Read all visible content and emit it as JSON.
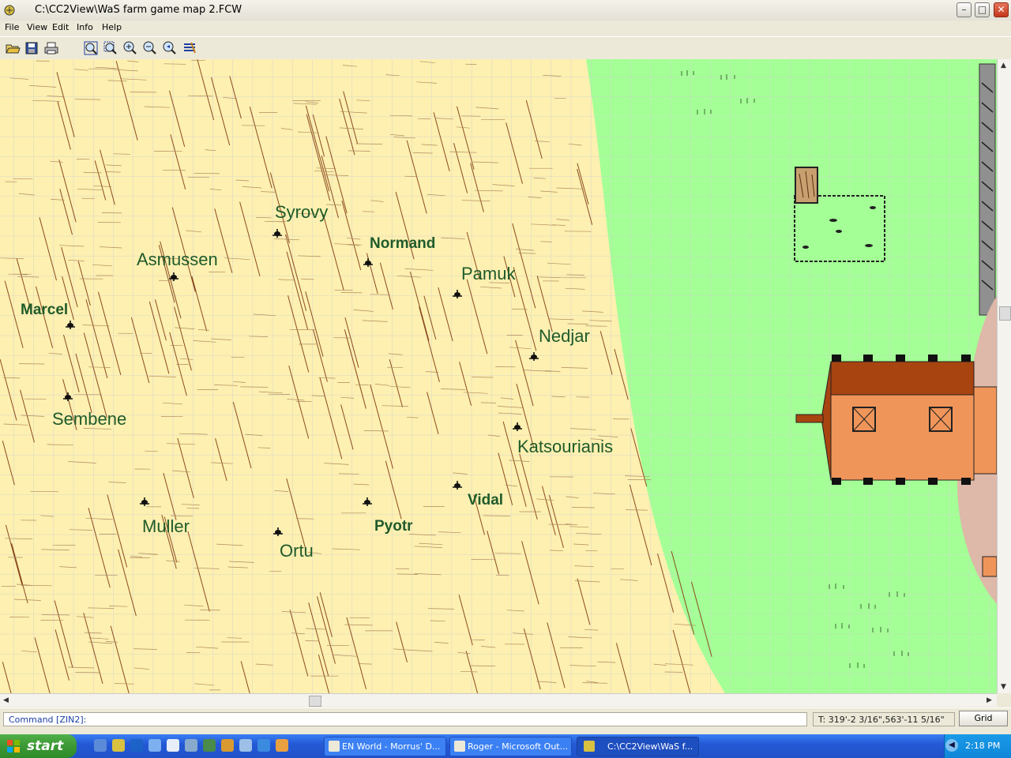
{
  "window": {
    "title": "C:\\CC2View\\WaS farm game map 2.FCW",
    "minimize": "–",
    "maximize": "□",
    "close": "✕"
  },
  "menu": [
    "File",
    "View",
    "Edit",
    "Info",
    "Help"
  ],
  "toolbar": {
    "icons": [
      "open-icon",
      "save-icon",
      "print-icon",
      "zoom-extents-icon",
      "zoom-window-icon",
      "zoom-in-icon",
      "zoom-out-icon",
      "zoom-previous-icon",
      "layers-icon"
    ]
  },
  "map": {
    "labels": [
      {
        "name": "Syrovy",
        "bold": false
      },
      {
        "name": "Normand",
        "bold": true
      },
      {
        "name": "Asmussen",
        "bold": false
      },
      {
        "name": "Pamuk",
        "bold": false
      },
      {
        "name": "Marcel",
        "bold": true
      },
      {
        "name": "Nedjar",
        "bold": false
      },
      {
        "name": "Sembene",
        "bold": false
      },
      {
        "name": "Katsourianis",
        "bold": false
      },
      {
        "name": "Vidal",
        "bold": true
      },
      {
        "name": "Muller",
        "bold": false
      },
      {
        "name": "Pyotr",
        "bold": true
      },
      {
        "name": "Ortu",
        "bold": false
      }
    ],
    "colors": {
      "field": "#fdf0b0",
      "grass": "#a4ff96",
      "grid": "#c8c8c8",
      "label": "#1f5a2a",
      "barn_roof": "#a84410",
      "barn_wall": "#f0955a"
    }
  },
  "statusbar": {
    "command": "Command [ZIN2]:",
    "coords": "T: 319'-2 3/16\",563'-11 5/16\"",
    "grid_button": "Grid"
  },
  "taskbar": {
    "start": "start",
    "tasks": [
      {
        "label": "EN World - Morrus' D...",
        "active": false
      },
      {
        "label": "Roger - Microsoft Out...",
        "active": false
      },
      {
        "label": "C:\\CC2View\\WaS f...",
        "active": true
      }
    ],
    "clock": "2:18 PM"
  }
}
